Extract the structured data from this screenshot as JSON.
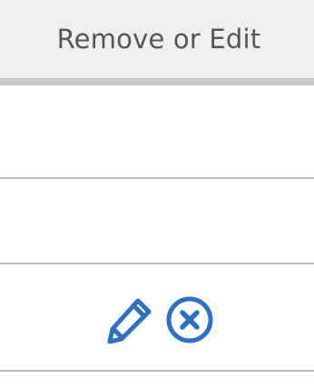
{
  "table": {
    "column_header": "Remove or Edit",
    "rows": [
      {
        "actions": []
      },
      {
        "actions": []
      },
      {
        "actions": [
          "edit",
          "remove"
        ]
      }
    ]
  },
  "icons": {
    "edit": "pencil-icon",
    "remove": "circle-x-icon"
  },
  "colors": {
    "header_bg": "#efefef",
    "header_text": "#555555",
    "header_border": "#c8c8c8",
    "row_border": "#bdbdbd",
    "icon_accent": "#2f6fc0"
  }
}
